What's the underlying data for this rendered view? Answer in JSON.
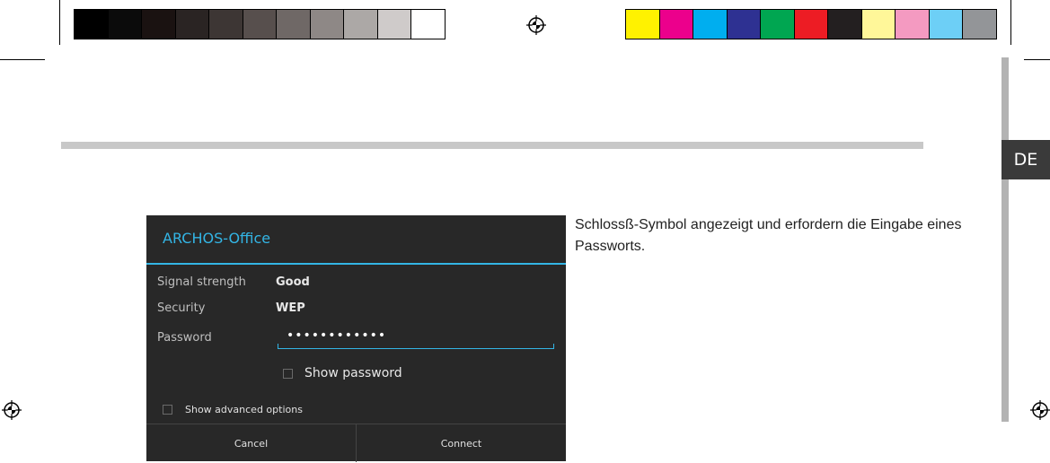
{
  "color_bars": {
    "grayscale": [
      "#000000",
      "#0b0b0b",
      "#1a1211",
      "#2a2423",
      "#3d3634",
      "#574f4d",
      "#6f6866",
      "#8e8886",
      "#aca8a6",
      "#cfcbca",
      "#ffffff"
    ],
    "colors": [
      "#fff200",
      "#ec008c",
      "#00aeef",
      "#2e3192",
      "#00a651",
      "#ed1c24",
      "#231f20",
      "#fff799",
      "#f49ac1",
      "#6dcff6",
      "#939598"
    ]
  },
  "language_tab": "DE",
  "dialog": {
    "title": "ARCHOS-Office",
    "signal_strength_label": "Signal strength",
    "signal_strength_value": "Good",
    "security_label": "Security",
    "security_value": "WEP",
    "password_label": "Password",
    "password_masked": "••••••••••••",
    "show_password_label": "Show password",
    "show_advanced_label": "Show advanced options",
    "cancel_label": "Cancel",
    "connect_label": "Connect",
    "accent_color": "#33b5e5"
  },
  "body_text": "Schlossß-Symbol angezeigt und erfordern die Eingabe eines Passworts."
}
